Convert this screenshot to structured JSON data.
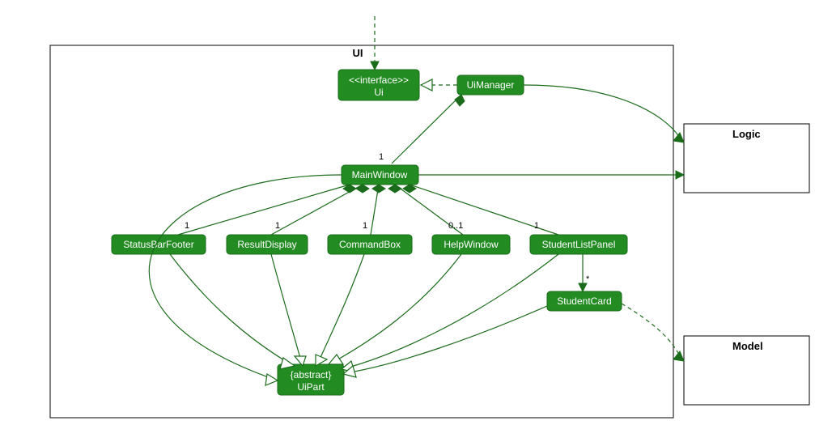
{
  "packages": {
    "ui": {
      "label": "UI"
    },
    "logic": {
      "label": "Logic"
    },
    "model": {
      "label": "Model"
    }
  },
  "nodes": {
    "ui_if": {
      "stereotype": "<<interface>>",
      "name": "Ui"
    },
    "ui_manager": {
      "name": "UiManager"
    },
    "main_window": {
      "name": "MainWindow"
    },
    "status_bar": {
      "name": "StatusBarFooter"
    },
    "result_display": {
      "name": "ResultDisplay"
    },
    "command_box": {
      "name": "CommandBox"
    },
    "help_window": {
      "name": "HelpWindow"
    },
    "student_list_panel": {
      "name": "StudentListPanel"
    },
    "student_card": {
      "name": "StudentCard"
    },
    "ui_part": {
      "stereotype": "{abstract}",
      "name": "UiPart"
    }
  },
  "multiplicities": {
    "mw_to_um": "1",
    "mw_to_status": "1",
    "mw_to_result": "1",
    "mw_to_cmd": "1",
    "mw_to_help": "0..1",
    "mw_to_slp": "1",
    "slp_to_sc": "*"
  }
}
